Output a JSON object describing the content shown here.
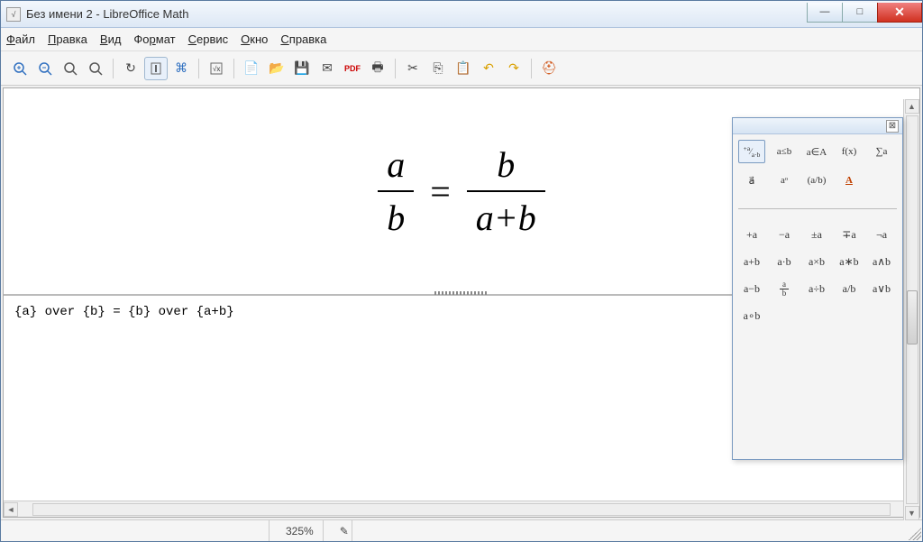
{
  "titlebar": {
    "title": "Без имени 2 - LibreOffice Math"
  },
  "menu": {
    "file": "Файл",
    "edit": "Правка",
    "view": "Вид",
    "format": "Формат",
    "tools": "Сервис",
    "window": "Окно",
    "help": "Справка"
  },
  "toolbar_icons": {
    "zoom_in": "zoom-in",
    "zoom_out": "zoom-out",
    "zoom_100": "zoom-100",
    "zoom_fit": "zoom-fit",
    "update": "update",
    "cursor": "cursor",
    "catalog": "catalog",
    "formula": "formula",
    "new": "new",
    "open": "open",
    "save": "save",
    "mail": "mail",
    "pdf": "pdf",
    "print": "print",
    "cut": "cut",
    "copy": "copy",
    "paste": "paste",
    "undo": "undo",
    "redo": "redo",
    "help": "help"
  },
  "formula": {
    "frac1_num": "a",
    "frac1_den": "b",
    "eq": "=",
    "frac2_num": "b",
    "frac2_den": "a+b"
  },
  "code": "{a} over {b} = {b} over {a+b}",
  "statusbar": {
    "zoom": "325%"
  },
  "elements": {
    "categories": [
      "+a⁄a∙b",
      "a≤b",
      "a∈A",
      "f(x)",
      "∑a",
      "a⃗",
      "aᵃ",
      "(a/b)",
      "A̲"
    ],
    "operators": [
      "+a",
      "−a",
      "±a",
      "∓a",
      "¬a",
      "a+b",
      "a·b",
      "a×b",
      "a∗b",
      "a∧b",
      "a−b",
      "a/b",
      "a÷b",
      "a/b",
      "a∨b",
      "a∘b"
    ],
    "op_fraction": "a⁄b"
  }
}
